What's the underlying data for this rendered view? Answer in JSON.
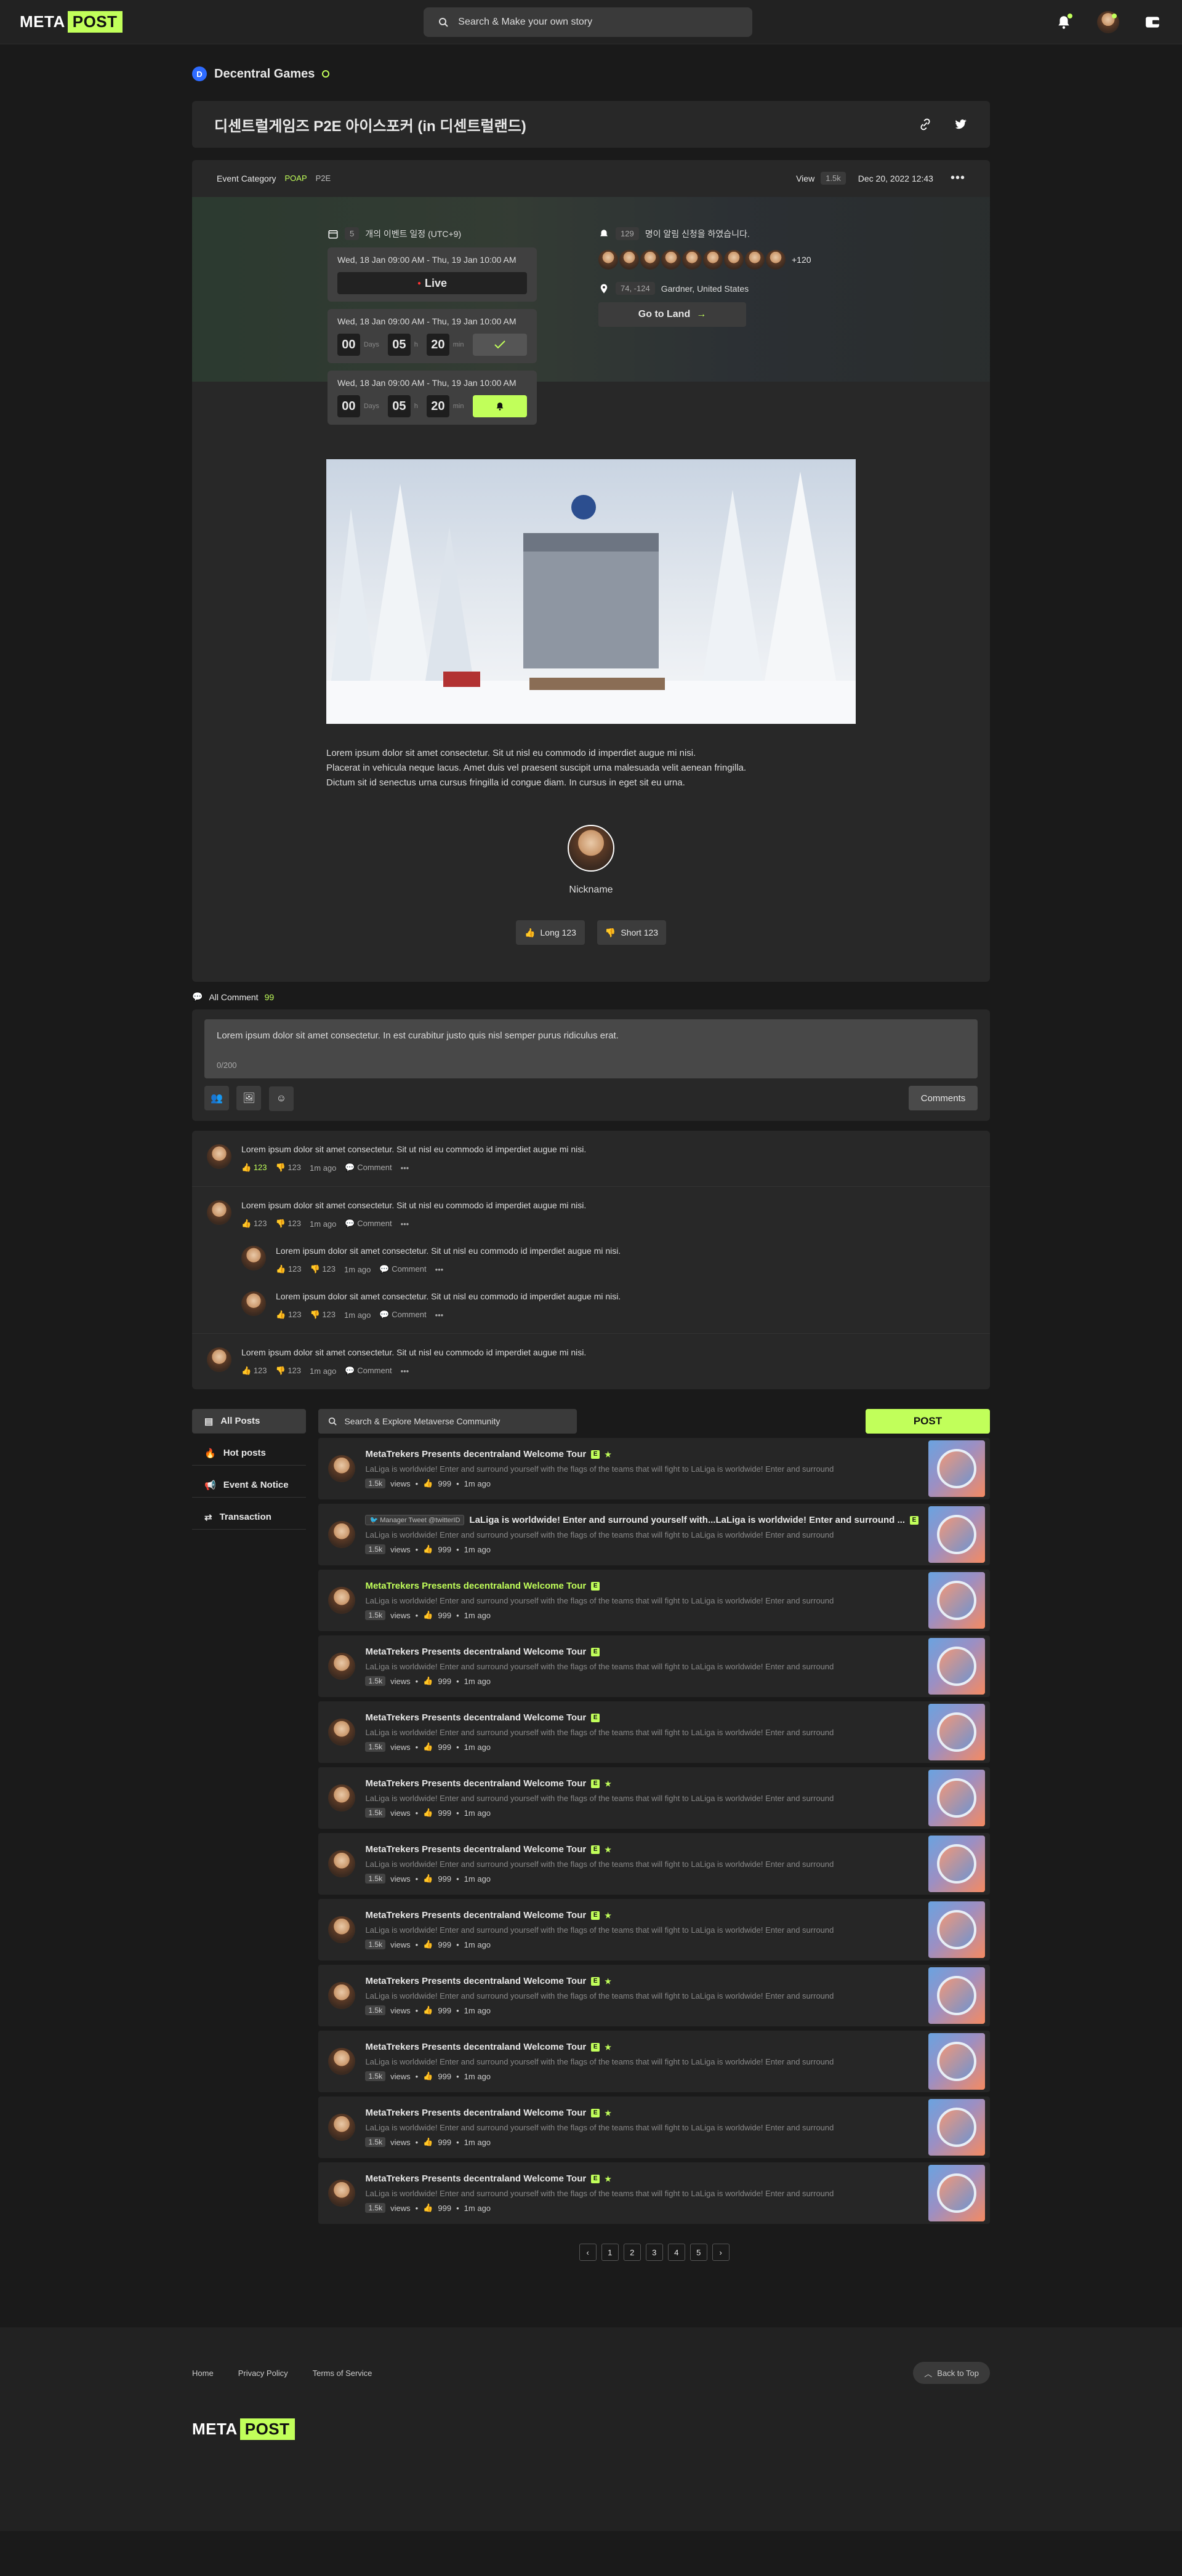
{
  "header": {
    "logo_word": "META",
    "logo_badge": "POST",
    "search_placeholder": "Search & Make your own story"
  },
  "brand": {
    "name": "Decentral Games",
    "icon_letter": "D"
  },
  "event": {
    "title": "디센트럴게임즈 P2E 아이스포커 (in 디센트럴랜드)",
    "category_label": "Event Category",
    "tags": [
      "POAP",
      "P2E"
    ],
    "view_label": "View",
    "view_count": "1.5k",
    "date": "Dec 20, 2022 12:43",
    "schedule_count": "5",
    "schedule_label": "개의 이벤트 일정 (UTC+9)",
    "slots": [
      {
        "when": "Wed, 18 Jan 09:00 AM - Thu, 19 Jan 10:00 AM",
        "status": "Live"
      },
      {
        "when": "Wed, 18 Jan 09:00 AM - Thu, 19 Jan 10:00 AM",
        "days": "00",
        "hours": "05",
        "mins": "20"
      },
      {
        "when": "Wed, 18 Jan 09:00 AM - Thu, 19 Jan 10:00 AM",
        "days": "00",
        "hours": "05",
        "mins": "20"
      }
    ],
    "unit_days": "Days",
    "unit_h": "h",
    "unit_min": "min",
    "alarm_count": "129",
    "alarm_label": "명이 알림 신청을 하였습니다.",
    "more_count": "+120",
    "coords": "74, -124",
    "location": "Gardner, United States",
    "go_land": "Go to Land",
    "description": [
      "Lorem ipsum dolor sit amet consectetur. Sit ut nisl eu commodo id imperdiet augue mi nisi.",
      "Placerat in vehicula neque lacus. Amet duis vel praesent suscipit urna malesuada velit aenean fringilla.",
      "Dictum sit id senectus urna cursus fringilla id congue diam. In cursus in eget sit eu urna."
    ],
    "author_nickname": "Nickname",
    "long_label": "Long 123",
    "short_label": "Short 123"
  },
  "comments": {
    "header_label": "All Comment",
    "count": "99",
    "input_text": "Lorem ipsum dolor sit amet consectetur. In est curabitur justo quis nisl semper purus ridiculus erat.",
    "char_count": "0/200",
    "submit_label": "Comments",
    "text": "Lorem ipsum dolor sit amet consectetur. Sit ut nisl eu commodo id imperdiet augue mi nisi.",
    "likes": "123",
    "dislikes": "123",
    "time": "1m ago",
    "comment_label": "Comment"
  },
  "sidebar": {
    "items": [
      {
        "label": "All Posts",
        "icon": "document-icon"
      },
      {
        "label": "Hot posts",
        "icon": "fire-icon"
      },
      {
        "label": "Event & Notice",
        "icon": "megaphone-icon"
      },
      {
        "label": "Transaction",
        "icon": "swap-icon"
      }
    ]
  },
  "feed": {
    "search_placeholder": "Search & Explore Metaverse Community",
    "post_button": "POST",
    "post_title": "MetaTrekers Presents decentraland Welcome Tour",
    "post_desc": "LaLiga is worldwide! Enter and surround yourself with the flags of the teams that will fight to LaLiga is worldwide! Enter and surround",
    "tweet_badge": "Manager Tweet",
    "tweet_handle": "@twitterID",
    "tweet_title": "LaLiga is worldwide! Enter and surround yourself with...LaLiga is worldwide! Enter and surround ...",
    "views": "1.5k",
    "views_label": "views",
    "likes": "999",
    "time": "1m ago",
    "e_badge": "E",
    "pages": [
      "1",
      "2",
      "3",
      "4",
      "5"
    ]
  },
  "footer": {
    "links": [
      "Home",
      "Privacy Policy",
      "Terms of Service"
    ],
    "back_to_top": "Back to Top"
  },
  "colors": {
    "accent": "#c1ff5a",
    "background": "#1a1a1a",
    "card": "#282828"
  }
}
